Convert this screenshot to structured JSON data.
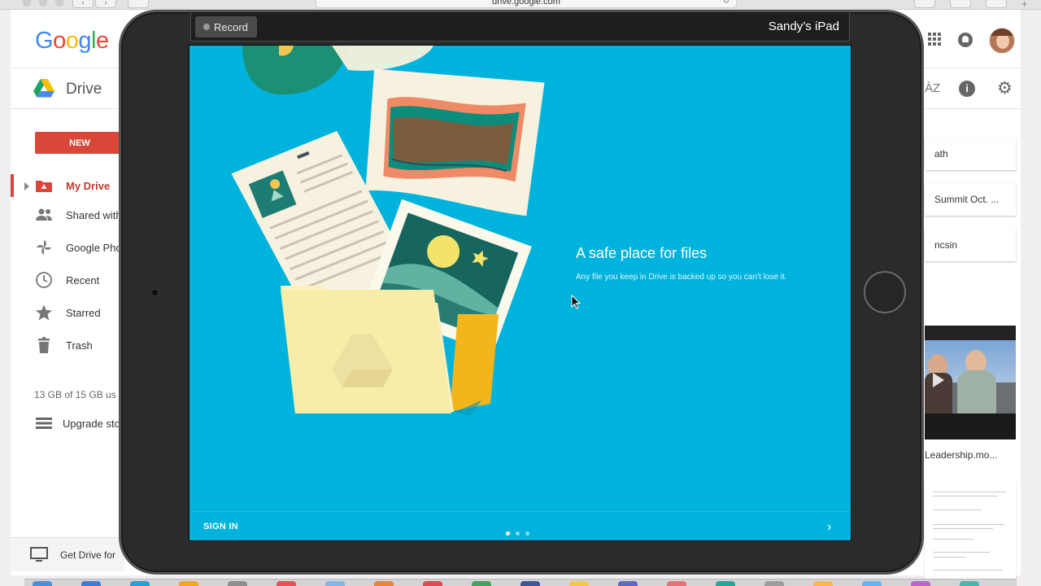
{
  "browser": {
    "url": "drive.google.com",
    "back_icon": "chevron-left-icon",
    "forward_icon": "chevron-right-icon"
  },
  "drive": {
    "logo_text": "Google",
    "app_title": "Drive",
    "new_button": "NEW",
    "sidebar": [
      {
        "label": "My Drive",
        "icon": "drive-folder-icon",
        "active": true
      },
      {
        "label": "Shared with",
        "icon": "people-icon"
      },
      {
        "label": "Google Pho",
        "icon": "pinwheel-icon"
      },
      {
        "label": "Recent",
        "icon": "clock-icon"
      },
      {
        "label": "Starred",
        "icon": "star-icon"
      },
      {
        "label": "Trash",
        "icon": "trash-icon"
      }
    ],
    "storage": "13 GB of 15 GB us",
    "upgrade": "Upgrade sto",
    "get_drive": "Get Drive for",
    "files": [
      "ath",
      "Summit Oct. ...",
      "ncsin"
    ],
    "video_name": "Leadership.mo...",
    "colors": {
      "new_button": "#d9473a",
      "active_text": "#c5392d"
    }
  },
  "ipad": {
    "record_label": "Record",
    "device_name": "Sandy’s iPad",
    "screen": {
      "headline": "A safe place for files",
      "subline": "Any file you keep in Drive is backed up so you can’t lose it.",
      "sign_in": "SIGN IN",
      "pages_total": 3,
      "current_page": 1,
      "background": "#00b3dc"
    }
  }
}
